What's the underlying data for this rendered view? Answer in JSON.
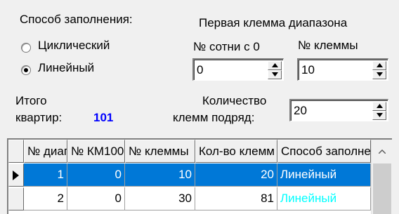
{
  "fill_mode": {
    "label": "Способ заполнения:",
    "options": [
      {
        "label": "Циклический",
        "selected": false
      },
      {
        "label": "Линейный",
        "selected": true
      }
    ]
  },
  "first_terminal": {
    "label": "Первая клемма диапазона",
    "hundred_label": "№ сотни с 0",
    "hundred_value": "0",
    "terminal_label": "№ клеммы",
    "terminal_value": "10"
  },
  "total": {
    "label_line1": "Итого",
    "label_line2": "квартир:",
    "value": "101"
  },
  "terminal_count": {
    "label_line1": "Количество",
    "label_line2": "клемм подряд:",
    "value": "20"
  },
  "table": {
    "columns": [
      "№ диапазона",
      "№ КМ100",
      "№ клеммы",
      "Кол-во клемм",
      "Способ заполнения"
    ],
    "rows": [
      {
        "range": "1",
        "km": "0",
        "terminal": "10",
        "count": "20",
        "mode": "Линейный",
        "selected": true
      },
      {
        "range": "2",
        "km": "0",
        "terminal": "30",
        "count": "81",
        "mode": "Линейный",
        "selected": false
      }
    ]
  },
  "colors": {
    "selection": "#0078d7",
    "mode_text": "#00ffff",
    "total_value": "#0000ff"
  }
}
